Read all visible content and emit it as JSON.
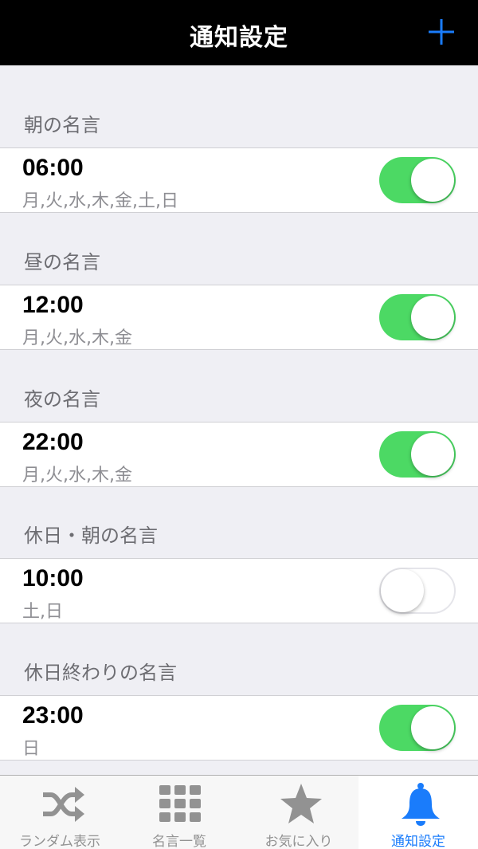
{
  "navbar": {
    "title": "通知設定",
    "add_icon": "plus-icon",
    "accent": "#1a7cfb"
  },
  "sections": [
    {
      "header": "朝の名言",
      "time": "06:00",
      "days": "月,火,水,木,金,土,日",
      "enabled": true
    },
    {
      "header": "昼の名言",
      "time": "12:00",
      "days": "月,火,水,木,金",
      "enabled": true
    },
    {
      "header": "夜の名言",
      "time": "22:00",
      "days": "月,火,水,木,金",
      "enabled": true
    },
    {
      "header": "休日・朝の名言",
      "time": "10:00",
      "days": "土,日",
      "enabled": false
    },
    {
      "header": "休日終わりの名言",
      "time": "23:00",
      "days": "日",
      "enabled": true
    }
  ],
  "tabbar": {
    "tabs": [
      {
        "label": "ランダム表示",
        "icon": "shuffle-icon",
        "active": false
      },
      {
        "label": "名言一覧",
        "icon": "grid-icon",
        "active": false
      },
      {
        "label": "お気に入り",
        "icon": "star-icon",
        "active": false
      },
      {
        "label": "通知設定",
        "icon": "bell-icon",
        "active": true
      }
    ]
  },
  "colors": {
    "switch_on": "#4cd964",
    "tab_active": "#1a7cfb",
    "tab_inactive": "#929292"
  }
}
